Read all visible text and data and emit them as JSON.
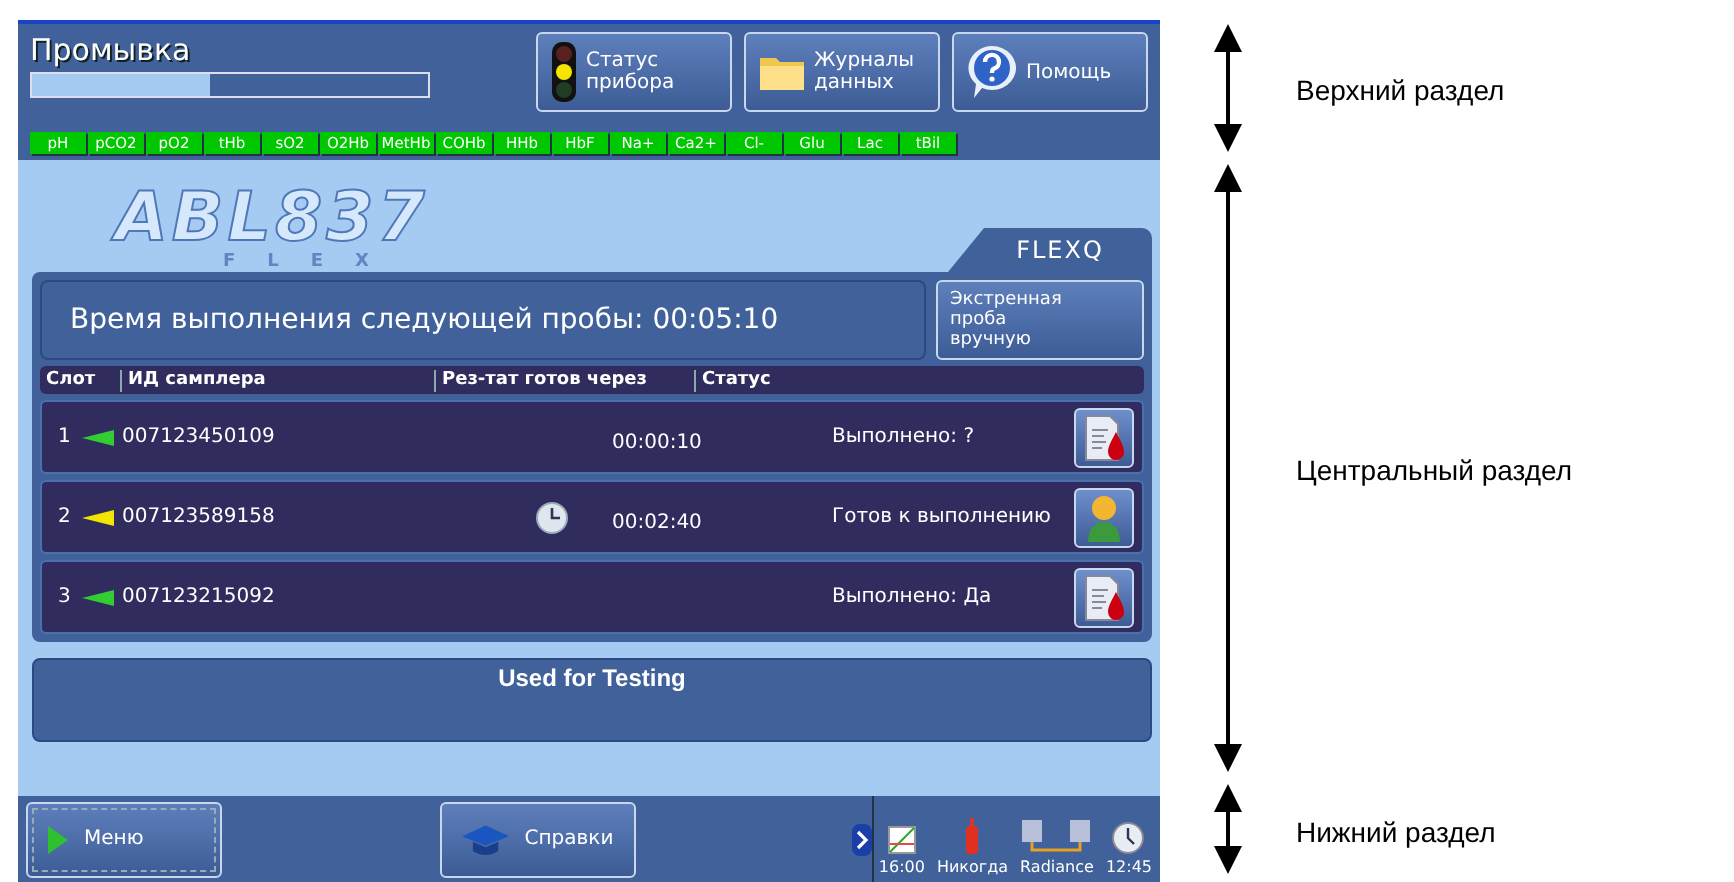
{
  "screen": {
    "title": "Промывка",
    "progress": {
      "level": 0.45
    },
    "top_buttons": [
      {
        "kind": "status",
        "label": "Статус\nприбора"
      },
      {
        "kind": "folder",
        "label": "Журналы\nданных"
      },
      {
        "kind": "help",
        "label": "Помощь"
      }
    ],
    "parameters": [
      "pH",
      "pCO2",
      "pO2",
      "tHb",
      "sO2",
      "O2Hb",
      "MetHb",
      "COHb",
      "HHb",
      "HbF",
      "Na+",
      "Ca2+",
      "Cl-",
      "Glu",
      "Lac",
      "tBil"
    ],
    "logo": {
      "name": "ABL837",
      "sub": "FLEX"
    },
    "tab": "FLEXQ",
    "next_sample": "Время выполнения следующей пробы: 00:05:10",
    "stat_button": "Экстренная\nпроба\nвручную",
    "table": {
      "columns": [
        "Слот",
        "ИД самплера",
        "Рез-тат готов через",
        "Статус"
      ],
      "rows": [
        {
          "slot": "1",
          "color": "#33cc33",
          "sampler_id": "007123450109",
          "timer": false,
          "time": "00:00:10",
          "status": "Выполнено: ?",
          "kind": "report"
        },
        {
          "slot": "2",
          "color": "#f2e600",
          "sampler_id": "007123589158",
          "timer": true,
          "time": "00:02:40",
          "status": "Готов к выполнению",
          "kind": "person"
        },
        {
          "slot": "3",
          "color": "#33cc33",
          "sampler_id": "007123215092",
          "timer": false,
          "status": "Выполнено: Да",
          "kind": "report"
        }
      ]
    },
    "message": "Used for Testing",
    "bottom": {
      "menu": "Меню",
      "reports": "Справки",
      "status_items": [
        {
          "kind": "chart",
          "label": "16:00"
        },
        {
          "kind": "bottle",
          "label": "Никогда"
        },
        {
          "kind": "network",
          "label": "Radiance"
        },
        {
          "kind": "clock",
          "label": "12:45"
        }
      ]
    }
  },
  "annotations": [
    {
      "label": "Верхний раздел"
    },
    {
      "label": "Центральный раздел"
    },
    {
      "label": "Нижний раздел"
    }
  ]
}
